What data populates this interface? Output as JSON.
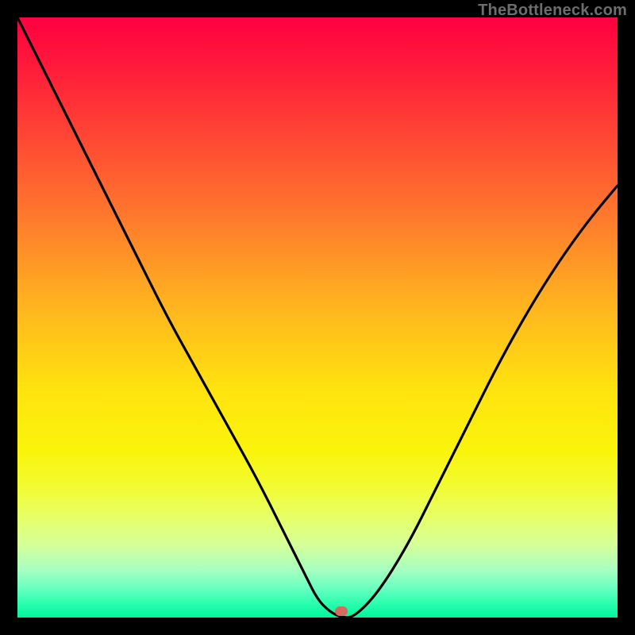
{
  "watermark": "TheBottleneck.com",
  "marker": {
    "x_pct": 54,
    "y_pct": 99
  },
  "chart_data": {
    "type": "line",
    "title": "",
    "xlabel": "",
    "ylabel": "",
    "xlim": [
      0,
      100
    ],
    "ylim": [
      0,
      100
    ],
    "grid": false,
    "legend": null,
    "series": [
      {
        "name": "curve",
        "x": [
          0,
          5,
          10,
          15,
          20,
          25,
          30,
          35,
          40,
          45,
          48,
          50,
          52,
          54,
          56,
          60,
          65,
          70,
          75,
          80,
          85,
          90,
          95,
          100
        ],
        "y": [
          100,
          90,
          80,
          70,
          60,
          50,
          41,
          32,
          23,
          13,
          7,
          3,
          1,
          0,
          0,
          4,
          12,
          22,
          32,
          42,
          51,
          59,
          66,
          72
        ]
      }
    ],
    "colors": {
      "curve": "#000000",
      "background_gradient_top": "#ff0040",
      "background_gradient_mid": "#ffe30f",
      "background_gradient_bottom": "#00f59b",
      "marker_fill": "#d56a5e"
    },
    "annotations": [
      {
        "type": "marker",
        "x": 54,
        "y": 0,
        "shape": "rounded-rect"
      }
    ]
  }
}
